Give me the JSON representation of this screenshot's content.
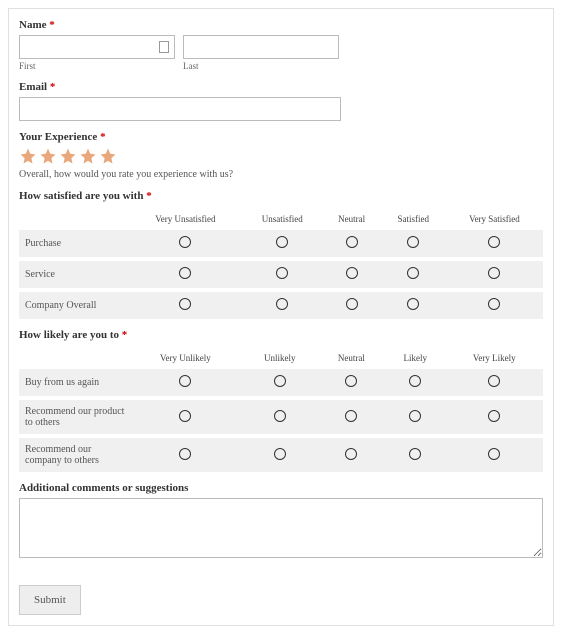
{
  "name": {
    "label": "Name",
    "first_sublabel": "First",
    "last_sublabel": "Last"
  },
  "email": {
    "label": "Email"
  },
  "experience": {
    "label": "Your Experience",
    "helper": "Overall, how would you rate you experience with us?",
    "rating": 5
  },
  "satisfaction": {
    "label": "How satisfied are you with",
    "columns": [
      "Very Unsatisfied",
      "Unsatisfied",
      "Neutral",
      "Satisfied",
      "Very Satisfied"
    ],
    "rows": [
      "Purchase",
      "Service",
      "Company Overall"
    ]
  },
  "likelihood": {
    "label": "How likely are you to",
    "columns": [
      "Very Unlikely",
      "Unlikely",
      "Neutral",
      "Likely",
      "Very Likely"
    ],
    "rows": [
      "Buy from us again",
      "Recommend our product to others",
      "Recommend our company to others"
    ]
  },
  "comments": {
    "label": "Additional comments or suggestions"
  },
  "submit": {
    "label": "Submit"
  },
  "required_marker": "*"
}
